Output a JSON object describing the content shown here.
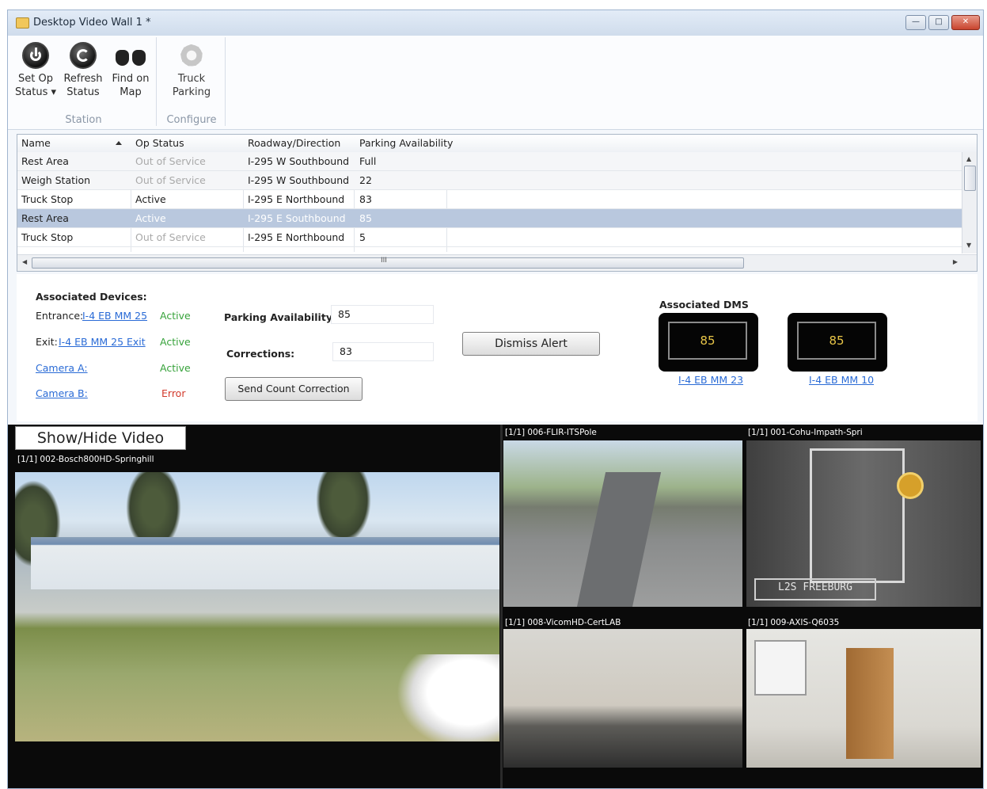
{
  "window": {
    "title": "Desktop Video Wall 1 *",
    "min_glyph": "—",
    "max_glyph": "□",
    "close_glyph": "✕"
  },
  "ribbon": {
    "station_group": {
      "label": "Station",
      "buttons": [
        {
          "line1": "Set Op",
          "line2": "Status ▾",
          "icon": "power-icon"
        },
        {
          "line1": "Refresh",
          "line2": "Status",
          "icon": "refresh-icon"
        },
        {
          "line1": "Find on",
          "line2": "Map",
          "icon": "binoculars-icon"
        }
      ]
    },
    "configure_group": {
      "label": "Configure",
      "buttons": [
        {
          "line1": "Truck",
          "line2": "Parking",
          "icon": "gear-icon"
        }
      ]
    }
  },
  "grid": {
    "columns": [
      "Name",
      "Op Status",
      "Roadway/Direction",
      "Parking Availability"
    ],
    "rows": [
      {
        "name": "Rest Area",
        "status": "Out of Service",
        "roadway": "I-295 W Southbound",
        "availability": "Full"
      },
      {
        "name": "Weigh Station",
        "status": "Out of Service",
        "roadway": "I-295 W Southbound",
        "availability": "22"
      },
      {
        "name": "Truck Stop",
        "status": "Active",
        "roadway": "I-295 E Northbound",
        "availability": "83"
      },
      {
        "name": "Rest Area",
        "status": "Active",
        "roadway": "I-295 E Southbound",
        "availability": "85"
      },
      {
        "name": "Truck Stop",
        "status": "Out of Service",
        "roadway": "I-295 E Northbound",
        "availability": "5"
      }
    ],
    "hscroll_mid": "III"
  },
  "details": {
    "devices_title": "Associated Devices:",
    "entrance_label": "Entrance:",
    "entrance_link": "I-4 EB MM 25",
    "entrance_status": "Active",
    "exit_label": "Exit:",
    "exit_link": "I-4 EB MM 25 Exit",
    "exit_status": "Active",
    "camera_a": "Camera A:",
    "camera_a_status": "Active",
    "camera_b": "Camera B:",
    "camera_b_status": "Error",
    "parking_label": "Parking Availability:",
    "parking_value": "85",
    "corrections_label": "Corrections:",
    "corrections_value": "83",
    "send_button": "Send Count Correction",
    "dismiss_button": "Dismiss Alert",
    "dms_title": "Associated DMS",
    "dms": [
      {
        "value": "85",
        "link": "I-4 EB MM 23"
      },
      {
        "value": "85",
        "link": "I-4 EB MM 10"
      }
    ]
  },
  "video": {
    "toggle": "Show/Hide Video",
    "main_label": "[1/1] 002-Bosch800HD-Springhill",
    "cams": [
      "[1/1] 006-FLIR-ITSPole",
      "[1/1] 001-Cohu-Impath-Spri",
      "[1/1] 008-VicomHD-CertLAB",
      "[1/1] 009-AXIS-Q6035"
    ],
    "sign_text": "L2S FREEBURG"
  }
}
